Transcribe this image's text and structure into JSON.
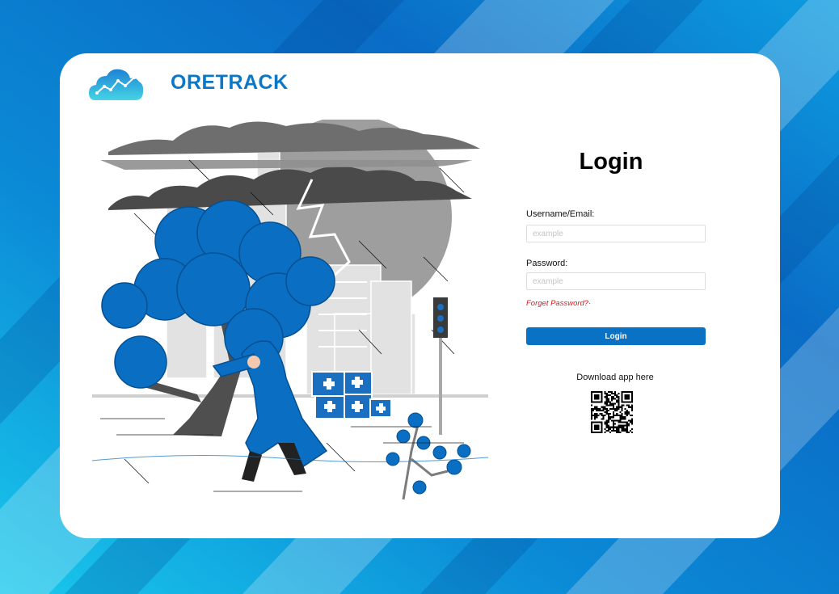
{
  "brand": {
    "name": "ORETRACK",
    "logo_icon": "cloud-chart-icon",
    "color": "#0a78c8"
  },
  "illustration": {
    "icon": "storm-city-illustration",
    "accent_color": "#0a6fc2"
  },
  "login": {
    "title": "Login",
    "username_label": "Username/Email:",
    "username_placeholder": "example",
    "username_value": "",
    "password_label": "Password:",
    "password_placeholder": "example",
    "password_value": "",
    "forgot_label": "Forget Password?·",
    "forgot_color": "#d81b1b",
    "submit_label": "Login",
    "submit_color": "#0a72c4"
  },
  "download": {
    "label": "Download app here",
    "qr_icon": "qr-code-icon"
  },
  "colors": {
    "background": "#0a74c8",
    "card": "#ffffff"
  }
}
